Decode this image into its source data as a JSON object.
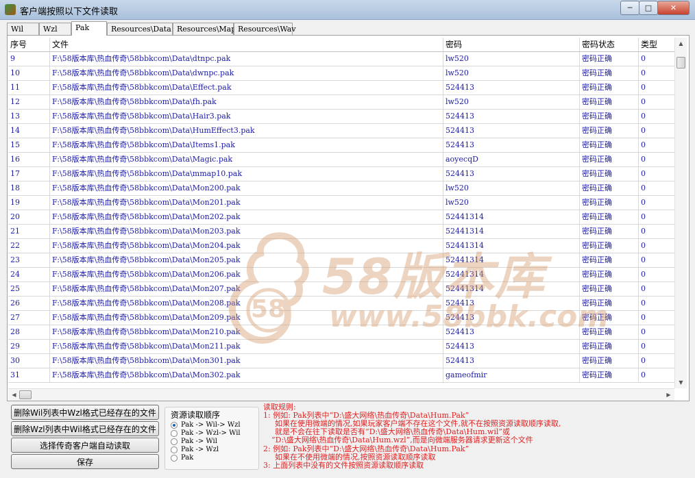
{
  "window": {
    "title": "客户端按照以下文件读取",
    "minimize": "─",
    "maximize": "□",
    "close": "✕"
  },
  "tabs": [
    {
      "label": "Wil",
      "active": false
    },
    {
      "label": "Wzl",
      "active": false
    },
    {
      "label": "Pak",
      "active": true
    },
    {
      "label": "Resources\\Data",
      "active": false
    },
    {
      "label": "Resources\\Map",
      "active": false
    },
    {
      "label": "Resources\\Wav",
      "active": false
    }
  ],
  "table": {
    "columns": [
      "序号",
      "文件",
      "密码",
      "密码状态",
      "类型"
    ],
    "rows": [
      [
        "9",
        "F:\\58版本库\\热血传奇\\58bbkcom\\Data\\dtnpc.pak",
        "lw520",
        "密码正确",
        "0"
      ],
      [
        "10",
        "F:\\58版本库\\热血传奇\\58bbkcom\\Data\\dwnpc.pak",
        "lw520",
        "密码正确",
        "0"
      ],
      [
        "11",
        "F:\\58版本库\\热血传奇\\58bbkcom\\Data\\Effect.pak",
        "524413",
        "密码正确",
        "0"
      ],
      [
        "12",
        "F:\\58版本库\\热血传奇\\58bbkcom\\Data\\fh.pak",
        "lw520",
        "密码正确",
        "0"
      ],
      [
        "13",
        "F:\\58版本库\\热血传奇\\58bbkcom\\Data\\Hair3.pak",
        "524413",
        "密码正确",
        "0"
      ],
      [
        "14",
        "F:\\58版本库\\热血传奇\\58bbkcom\\Data\\HumEffect3.pak",
        "524413",
        "密码正确",
        "0"
      ],
      [
        "15",
        "F:\\58版本库\\热血传奇\\58bbkcom\\Data\\Items1.pak",
        "524413",
        "密码正确",
        "0"
      ],
      [
        "16",
        "F:\\58版本库\\热血传奇\\58bbkcom\\Data\\Magic.pak",
        "aoyecqD",
        "密码正确",
        "0"
      ],
      [
        "17",
        "F:\\58版本库\\热血传奇\\58bbkcom\\Data\\mmap10.pak",
        "524413",
        "密码正确",
        "0"
      ],
      [
        "18",
        "F:\\58版本库\\热血传奇\\58bbkcom\\Data\\Mon200.pak",
        "lw520",
        "密码正确",
        "0"
      ],
      [
        "19",
        "F:\\58版本库\\热血传奇\\58bbkcom\\Data\\Mon201.pak",
        "lw520",
        "密码正确",
        "0"
      ],
      [
        "20",
        "F:\\58版本库\\热血传奇\\58bbkcom\\Data\\Mon202.pak",
        "52441314",
        "密码正确",
        "0"
      ],
      [
        "21",
        "F:\\58版本库\\热血传奇\\58bbkcom\\Data\\Mon203.pak",
        "52441314",
        "密码正确",
        "0"
      ],
      [
        "22",
        "F:\\58版本库\\热血传奇\\58bbkcom\\Data\\Mon204.pak",
        "52441314",
        "密码正确",
        "0"
      ],
      [
        "23",
        "F:\\58版本库\\热血传奇\\58bbkcom\\Data\\Mon205.pak",
        "52441314",
        "密码正确",
        "0"
      ],
      [
        "24",
        "F:\\58版本库\\热血传奇\\58bbkcom\\Data\\Mon206.pak",
        "52441314",
        "密码正确",
        "0"
      ],
      [
        "25",
        "F:\\58版本库\\热血传奇\\58bbkcom\\Data\\Mon207.pak",
        "52441314",
        "密码正确",
        "0"
      ],
      [
        "26",
        "F:\\58版本库\\热血传奇\\58bbkcom\\Data\\Mon208.pak",
        "524413",
        "密码正确",
        "0"
      ],
      [
        "27",
        "F:\\58版本库\\热血传奇\\58bbkcom\\Data\\Mon209.pak",
        "524413",
        "密码正确",
        "0"
      ],
      [
        "28",
        "F:\\58版本库\\热血传奇\\58bbkcom\\Data\\Mon210.pak",
        "524413",
        "密码正确",
        "0"
      ],
      [
        "29",
        "F:\\58版本库\\热血传奇\\58bbkcom\\Data\\Mon211.pak",
        "524413",
        "密码正确",
        "0"
      ],
      [
        "30",
        "F:\\58版本库\\热血传奇\\58bbkcom\\Data\\Mon301.pak",
        "524413",
        "密码正确",
        "0"
      ],
      [
        "31",
        "F:\\58版本库\\热血传奇\\58bbkcom\\Data\\Mon302.pak",
        "gameofmir",
        "密码正确",
        "0"
      ]
    ]
  },
  "watermark": {
    "title": "58版本库",
    "url": "www.58bbk.com",
    "badge": "58"
  },
  "buttons": {
    "delete_wil": "删除Wil列表中Wzl格式已经存在的文件",
    "delete_wzl": "删除Wzl列表中Wil格式已经存在的文件",
    "select_client": "选择传奇客户端自动读取",
    "save": "保存"
  },
  "read_order": {
    "title": "资源读取顺序",
    "options": [
      {
        "label": "Pak -> Wil-> Wzl",
        "selected": true
      },
      {
        "label": "Pak -> Wzl-> Wil",
        "selected": false
      },
      {
        "label": "Pak -> Wil",
        "selected": false
      },
      {
        "label": "Pak -> Wzl",
        "selected": false
      },
      {
        "label": "Pak",
        "selected": false
      }
    ]
  },
  "rules": {
    "heading": "读取规则:",
    "lines": [
      "1: 例如: Pak列表中“D:\\盛大网络\\热血传奇\\Data\\Hum.Pak”",
      "如果在使用微端的情况,如果玩家客户端不存在这个文件,就不在按照资源读取顺序读取,",
      "就是不会在往下读取是否有“D:\\盛大网络\\热血传奇\\Data\\Hum.wil”或",
      "“D:\\盛大网络\\热血传奇\\Data\\Hum.wzl”,而是向微端服务器请求更新这个文件",
      "2: 例如: Pak列表中“D:\\盛大网络\\热血传奇\\Data\\Hum.Pak”",
      "如果在不使用微端的情况,按照资源读取顺序读取",
      "3: 上面列表中没有的文件按照资源读取顺序读取"
    ]
  },
  "colors": {
    "data_text": "#1a1aa8",
    "rules_text": "#e02020",
    "watermark": "#d39a6a"
  }
}
